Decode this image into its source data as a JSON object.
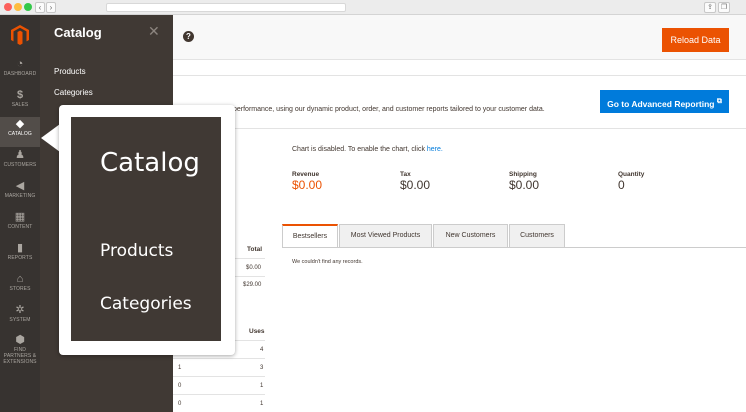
{
  "browser": {
    "back_glyph": "‹",
    "forward_glyph": "›",
    "share_icon": "share-icon",
    "tabs_icon": "tabs-icon"
  },
  "sidebar": {
    "logo_icon": "magento-logo",
    "items": [
      {
        "label": "DASHBOARD",
        "icon": "gauge-icon",
        "glyph": "◔"
      },
      {
        "label": "SALES",
        "icon": "dollar-icon",
        "glyph": "$"
      },
      {
        "label": "CATALOG",
        "icon": "cube-icon",
        "glyph": "◆"
      },
      {
        "label": "CUSTOMERS",
        "icon": "person-icon",
        "glyph": "♟"
      },
      {
        "label": "MARKETING",
        "icon": "megaphone-icon",
        "glyph": "◀"
      },
      {
        "label": "CONTENT",
        "icon": "layout-icon",
        "glyph": "▦"
      },
      {
        "label": "REPORTS",
        "icon": "bar-chart-icon",
        "glyph": "▮"
      },
      {
        "label": "STORES",
        "icon": "store-icon",
        "glyph": "⌂"
      },
      {
        "label": "SYSTEM",
        "icon": "gear-icon",
        "glyph": "✲"
      },
      {
        "label": "FIND PARTNERS & EXTENSIONS",
        "icon": "box-icon",
        "glyph": "⬢"
      }
    ]
  },
  "panel": {
    "title": "Catalog",
    "close_glyph": "✕",
    "links": [
      "Products",
      "Categories"
    ]
  },
  "header": {
    "help_glyph": "?",
    "reload_label": "Reload Data"
  },
  "dashboard": {
    "intro": "performance, using our dynamic product, order, and customer reports tailored to your customer data.",
    "advanced_label": "Go to Advanced Reporting",
    "advanced_glyph": "⧉",
    "chart_msg_prefix": "Chart is disabled. To enable the chart, click ",
    "chart_msg_link": "here.",
    "stats": [
      {
        "label": "Revenue",
        "value": "$0.00"
      },
      {
        "label": "Tax",
        "value": "$0.00"
      },
      {
        "label": "Shipping",
        "value": "$0.00"
      },
      {
        "label": "Quantity",
        "value": "0"
      }
    ],
    "tabs": [
      "Bestsellers",
      "Most Viewed Products",
      "New Customers",
      "Customers"
    ],
    "no_records": "We couldn't find any records.",
    "left_table_1": {
      "header": "Total",
      "rows": [
        "$0.00",
        "$29.00"
      ]
    },
    "left_table_2": {
      "header": "Uses",
      "rows": [
        {
          "a": "",
          "b": "4"
        },
        {
          "a": "1",
          "b": "3"
        },
        {
          "a": "0",
          "b": "1"
        },
        {
          "a": "0",
          "b": "1"
        }
      ]
    }
  },
  "callout": {
    "title": "Catalog",
    "links": [
      "Products",
      "Categories"
    ]
  },
  "colors": {
    "accent": "#eb5202",
    "link": "#007bdb",
    "sidebar": "#373330",
    "panel": "#403934"
  }
}
